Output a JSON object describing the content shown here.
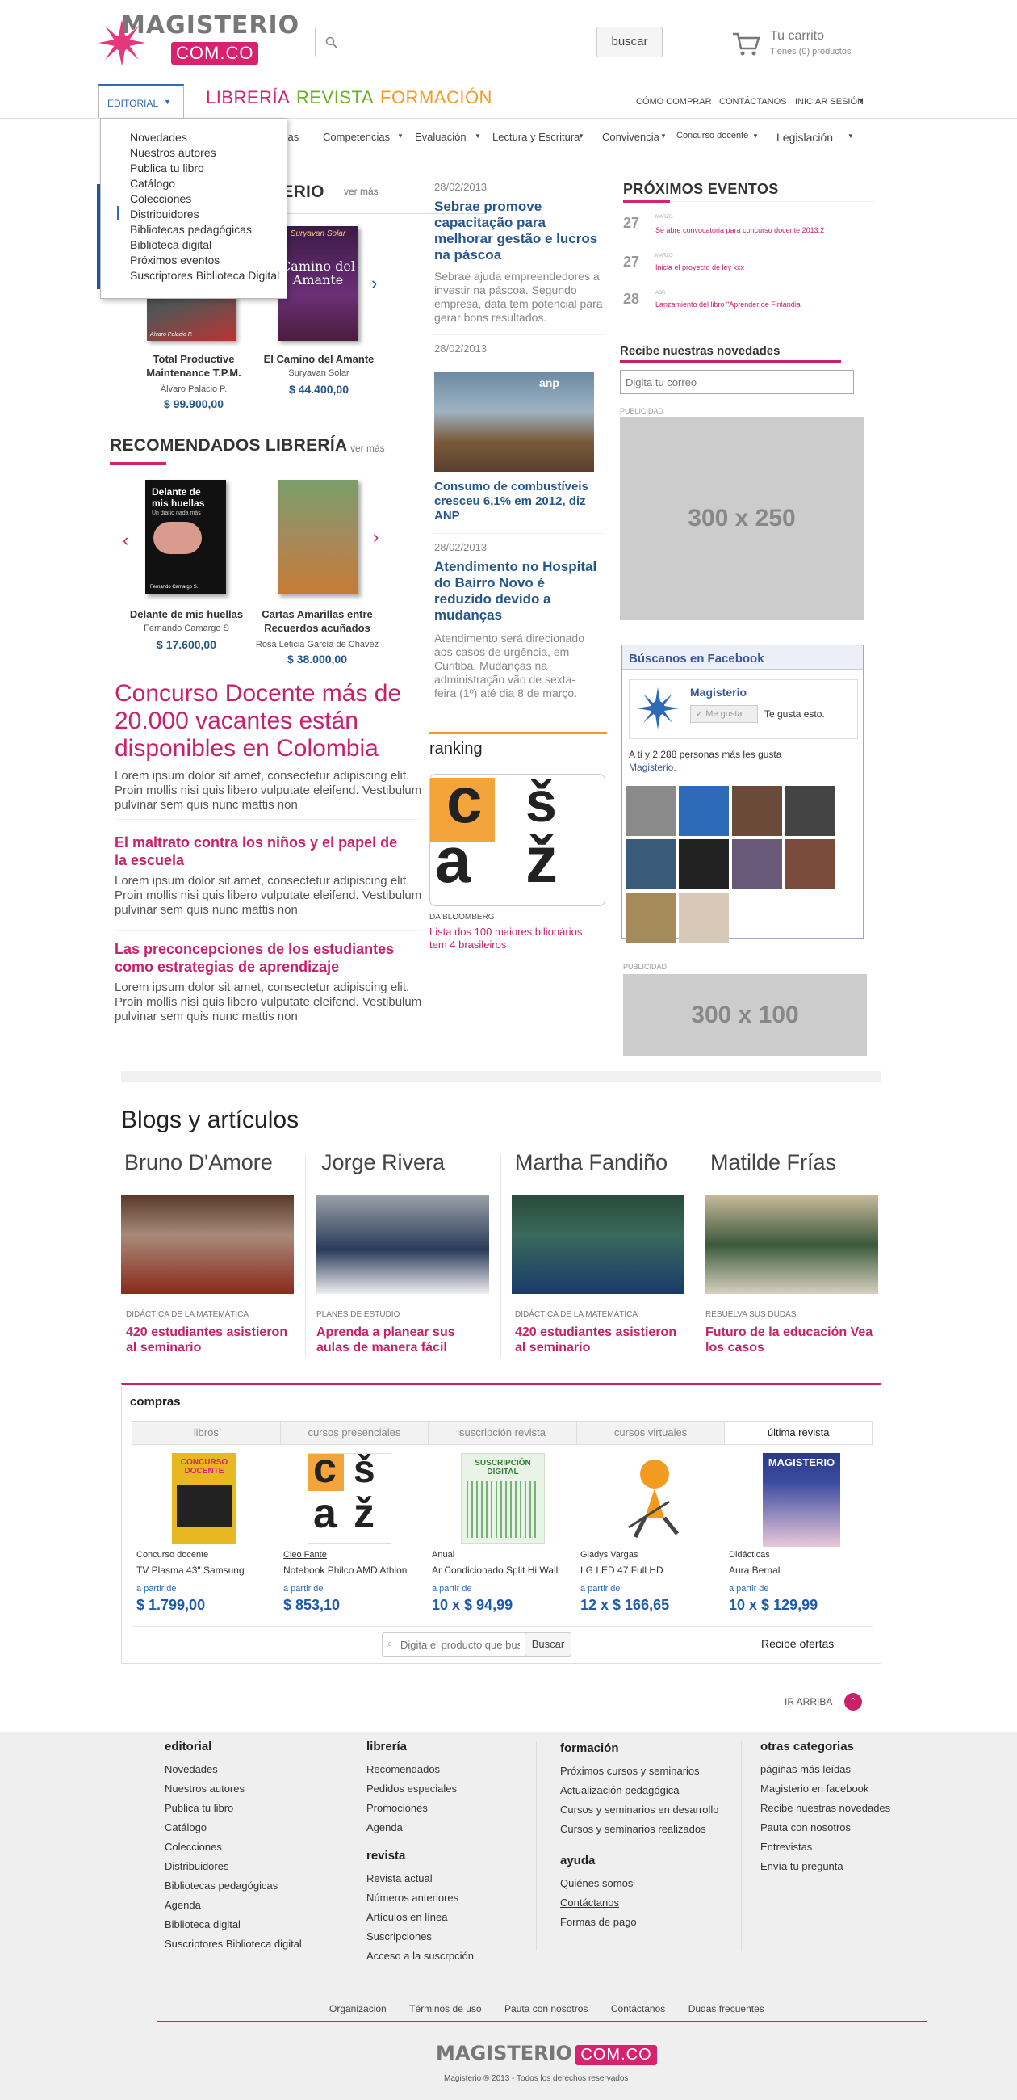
{
  "header": {
    "logo_main": "MAGISTERIO",
    "logo_com": "COM.CO",
    "search_placeholder": "",
    "search_button": "buscar",
    "cart_title": "Tu carrito",
    "cart_sub": "Tienes (0) productos"
  },
  "topnav": {
    "items": [
      "CÓMO COMPRAR",
      "CONTÁCTANOS",
      "INICIAR SESIÓN"
    ]
  },
  "mainnav": {
    "editorial": "EDITORIAL",
    "items": [
      {
        "label": "LIBRERÍA",
        "color": "#d6226f"
      },
      {
        "label": "REVISTA",
        "color": "#6ab023"
      },
      {
        "label": "FORMACIÓN",
        "color": "#f39b21"
      }
    ]
  },
  "subnav": {
    "items": [
      "cas",
      "Competencias",
      "Evaluación",
      "Lectura y Escritura",
      "Convivencia",
      "Concurso docente",
      "Legislación"
    ]
  },
  "dropdown": {
    "items": [
      "Novedades",
      "Nuestros autores",
      "Publica tu libro",
      "Catálogo",
      "Colecciones",
      "Distribuidores",
      "Bibliotecas pedagógicas",
      "Biblioteca digital",
      "Próximos eventos",
      "Suscriptores Biblioteca Digital"
    ]
  },
  "novedades": {
    "title_fragment": "ITERIO",
    "ver_mas": "ver más",
    "products": [
      {
        "title": "Total Productive Maintenance T.P.M.",
        "author": "Álvaro Palacio P.",
        "price": "$ 99.900,00"
      },
      {
        "title": "El Camino del Amante",
        "author": "Suryavan Solar",
        "price": "$ 44.400,00",
        "cover_line1": "Suryavan Solar",
        "cover_line2": "Camino del Amante"
      }
    ]
  },
  "recomendados": {
    "title": "RECOMENDADOS LIBRERÍA",
    "ver_mas": "ver más",
    "products": [
      {
        "title": "Delante de mis huellas",
        "author": "Fernando Camargo S",
        "price": "$ 17.600,00",
        "cover_line1": "Delante de mis huellas",
        "cover_line2": "Un diario nada más",
        "cover_author": "Fernando Camargo S."
      },
      {
        "title": "Cartas Amarillas entre Recuerdos acuñados",
        "author": "Rosa Leticia García de Chavez",
        "price": "$ 38.000,00"
      }
    ]
  },
  "articles": [
    {
      "title": "Concurso Docente más de 20.000 vacantes están disponibles en Colombia",
      "body": "Lorem ipsum dolor sit amet, consectetur adipiscing elit. Proin mollis nisi quis libero vulputate eleifend. Vestibulum pulvinar sem quis nunc mattis non"
    },
    {
      "title": "El maltrato contra los niños y el papel de la escuela",
      "body": "Lorem ipsum dolor sit amet, consectetur adipiscing elit. Proin mollis nisi quis libero vulputate eleifend. Vestibulum pulvinar sem quis nunc mattis non"
    },
    {
      "title": "Las preconcepciones de los estudiantes como estrategias de aprendizaje",
      "body": "Lorem ipsum dolor sit amet, consectetur adipiscing elit. Proin mollis nisi quis libero vulputate eleifend. Vestibulum pulvinar sem quis nunc mattis non"
    }
  ],
  "news": [
    {
      "date": "28/02/2013",
      "title": "Sebrae promove capacitação para melhorar gestão e lucros na páscoa",
      "body": "Sebrae ajuda empreendedores a investir na páscoa. Segundo empresa, data tem potencial para gerar bons resultados."
    },
    {
      "date": "28/02/2013",
      "title": "Consumo de combustíveis cresceu 6,1% em 2012, diz ANP",
      "photo_label": "anp"
    },
    {
      "date": "28/02/2013",
      "title": "Atendimento no Hospital do Bairro Novo é reduzido devido a mudanças",
      "body": "Atendimento será direcionado aos casos de urgência, em Curitiba. Mudanças na administração vão de sexta-feira (1º) até dia 8 de março."
    }
  ],
  "ranking": {
    "title": "ranking",
    "source": "DA BLOOMBERG",
    "link": "Lista dos 100 maiores bilionários tem 4 brasileiros",
    "img_letters": [
      "c",
      "š",
      "a",
      "ž"
    ]
  },
  "eventos": {
    "title": "PRÓXIMOS EVENTOS",
    "items": [
      {
        "day": "27",
        "month": "MARZO",
        "text": "Se abre convocatoria para concurso docente 2013.2"
      },
      {
        "day": "27",
        "month": "MARZO",
        "text": "Inicia el proyecto de ley xxx"
      },
      {
        "day": "28",
        "month": "ABR",
        "text": "Lanzamiento del libro \"Aprender de Finlandia"
      }
    ]
  },
  "newsletter": {
    "title": "Recibe nuestras novedades",
    "placeholder": "Digita tu correo"
  },
  "ads": {
    "label": "PUBLICIDAD",
    "big": "300 x 250",
    "small": "300 x 100"
  },
  "facebook": {
    "title": "Búscanos en Facebook",
    "page": "Magisterio",
    "like_button": "Me gusta",
    "like_text": "Te gusta esto.",
    "friends_text": "A ti y 2.288 personas más les gusta",
    "friends_link": "Magisterio."
  },
  "blogs": {
    "title": "Blogs y artículos",
    "items": [
      {
        "name": "Bruno D'Amore",
        "category": "DIDÁCTICA DE LA MATEMÁTICA",
        "title": "420 estudiantes asistieron al seminario"
      },
      {
        "name": "Jorge Rivera",
        "category": "PLANES DE ESTUDIO",
        "title": "Aprenda a planear sus aulas de manera fácil"
      },
      {
        "name": "Martha Fandiño",
        "category": "DIDÁCTICA DE LA MATEMÁTICA",
        "title": "420 estudiantes asistieron al seminario"
      },
      {
        "name": "Matilde Frías",
        "category": "RESUELVA SUS DUDAS",
        "title": "Futuro de la educación Vea los casos"
      }
    ]
  },
  "compras": {
    "title": "compras",
    "tabs": [
      "libros",
      "cursos presenciales",
      "suscripción revista",
      "cursos virtuales",
      "última revista"
    ],
    "items": [
      {
        "header": "Concurso docente",
        "name": "TV Plasma 43\" Samsung",
        "prefix": "a partir de",
        "price": "$ 1.799,00",
        "cover": "CONCURSO DOCENTE"
      },
      {
        "header": "Cleo Fante",
        "name": "Notebook Philco AMD Athlon",
        "prefix": "a partir de",
        "price": "$ 853,10"
      },
      {
        "header": "Anual",
        "name": "Ar Condicionado Split Hi Wall",
        "prefix": "a partir de",
        "price": "10 x $ 94,99",
        "cover": "SUSCRIPCIÓN DIGITAL"
      },
      {
        "header": "Gladys Vargas",
        "name": "LG LED 47 Full HD",
        "prefix": "a partir de",
        "price": "12 x $ 166,65"
      },
      {
        "header": "Didácticas",
        "name": "Aura Bernal",
        "prefix": "a partir de",
        "price": "10 x $ 129,99",
        "cover": "MAGISTERIO"
      }
    ],
    "search_placeholder": "Digita el producto que buscas",
    "search_button": "Buscar",
    "ofertas": "Recibe ofertas"
  },
  "ir_arriba": "IR ARRIBA",
  "footer": {
    "editorial": {
      "title": "editorial",
      "items": [
        "Novedades",
        "Nuestros autores",
        "Publica tu libro",
        "Catálogo",
        "Colecciones",
        "Distribuidores",
        "Bibliotecas pedagógicas",
        "Agenda",
        "Biblioteca digital",
        "Suscriptores Biblioteca digital"
      ]
    },
    "libreria": {
      "title": "librería",
      "items": [
        "Recomendados",
        "Pedidos especiales",
        "Promociones",
        "Agenda"
      ]
    },
    "revista": {
      "title": "revista",
      "items": [
        "Revista actual",
        "Números anteriores",
        "Artículos en línea",
        "Suscripciones",
        "Acceso a la suscrpción"
      ]
    },
    "formacion": {
      "title": "formación",
      "items": [
        "Próximos cursos y seminarios",
        "Actualización pedagógica",
        "Cursos y seminarios en desarrollo",
        "Cursos y seminarios realizados"
      ]
    },
    "ayuda": {
      "title": "ayuda",
      "items": [
        "Quiénes somos",
        "Contáctanos",
        "Formas de pago"
      ]
    },
    "otras": {
      "title": "otras categorias",
      "items": [
        "páginas más leídas",
        "Magisterio en facebook",
        "Recibe nuestras novedades",
        "Pauta con nosotros",
        "Entrevistas",
        "Envía tu pregunta"
      ]
    },
    "bottom_links": [
      "Organización",
      "Términos de uso",
      "Pauta con nosotros",
      "Contáctanos",
      "Dudas frecuentes"
    ],
    "copyright": "Magisterio ® 2013 - Todos los derechos reservados"
  }
}
